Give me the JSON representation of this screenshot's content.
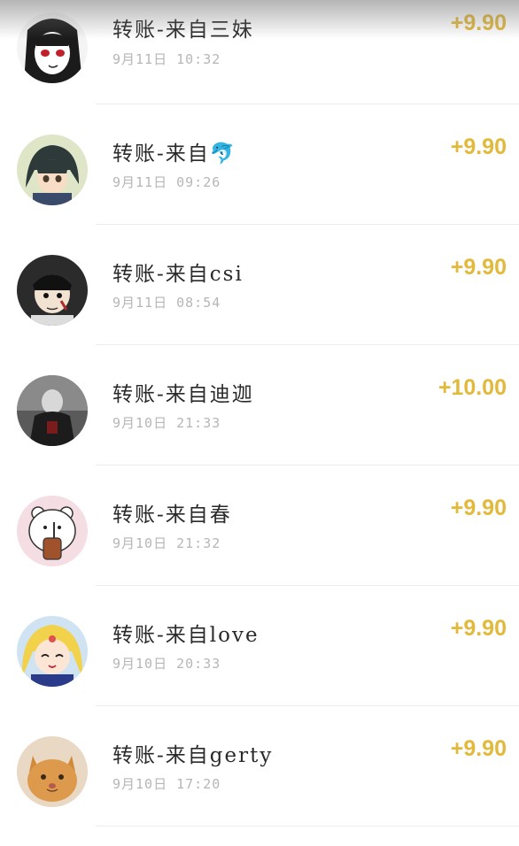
{
  "transactions": [
    {
      "title": "转账-来自三妹",
      "time": "9月11日 10:32",
      "amount": "+9.90",
      "avatar": "anime-girl-dark-hair"
    },
    {
      "title": "转账-来自🐬",
      "time": "9月11日 09:26",
      "amount": "+9.90",
      "avatar": "anime-boy-green"
    },
    {
      "title": "转账-来自csi",
      "time": "9月11日 08:54",
      "amount": "+9.90",
      "avatar": "anime-character-dark"
    },
    {
      "title": "转账-来自迪迦",
      "time": "9月10日 21:33",
      "amount": "+10.00",
      "avatar": "photo-dark-figure"
    },
    {
      "title": "转账-来自春",
      "time": "9月10日 21:32",
      "amount": "+9.90",
      "avatar": "cartoon-bear-drink"
    },
    {
      "title": "转账-来自love",
      "time": "9月10日 20:33",
      "amount": "+9.90",
      "avatar": "sailor-moon-character"
    },
    {
      "title": "转账-来自gerty",
      "time": "9月10日 17:20",
      "amount": "+9.90",
      "avatar": "orange-cat-photo"
    }
  ],
  "colors": {
    "amount": "#e3b93b",
    "title": "#2a2a2a",
    "time": "#b6b6b6"
  }
}
